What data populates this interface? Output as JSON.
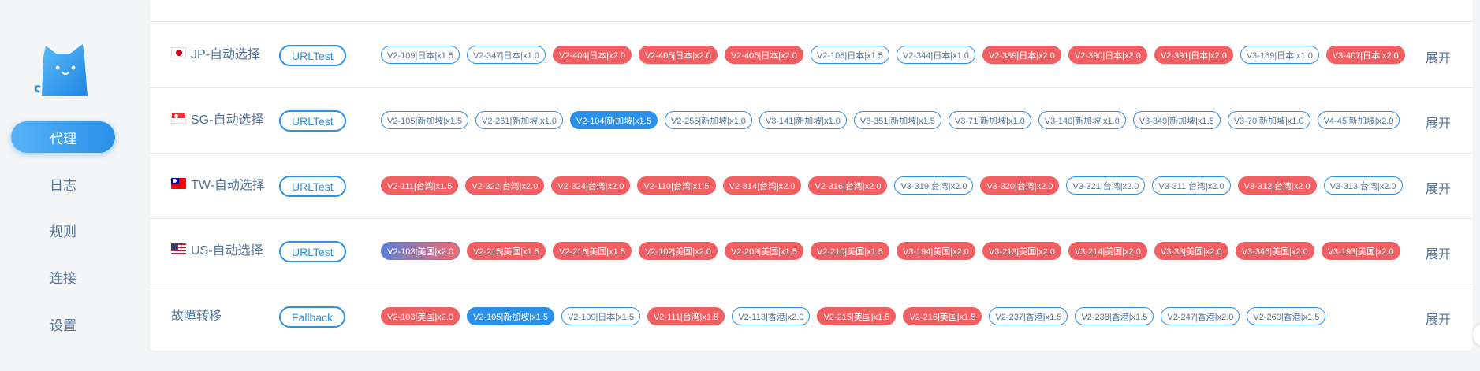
{
  "sidebar": {
    "logo_icon": "cat-logo-icon",
    "items": [
      {
        "label": "代理",
        "active": true
      },
      {
        "label": "日志",
        "active": false
      },
      {
        "label": "规则",
        "active": false
      },
      {
        "label": "连接",
        "active": false
      },
      {
        "label": "设置",
        "active": false
      }
    ]
  },
  "colors": {
    "accent": "#2a90ea",
    "tag_red": "#f25f62",
    "text": "#54759a"
  },
  "groups": [
    {
      "name": "JP-自动选择",
      "flag_icon": "japan-flag-icon",
      "type": "URLTest",
      "expand_label": "展开",
      "proxies": [
        {
          "label": "V2-109|日本|x1.5",
          "style": "outline"
        },
        {
          "label": "V2-347|日本|x1.0",
          "style": "outline"
        },
        {
          "label": "V2-404|日本|x2.0",
          "style": "red"
        },
        {
          "label": "V2-405|日本|x2.0",
          "style": "red"
        },
        {
          "label": "V2-406|日本|x2.0",
          "style": "red"
        },
        {
          "label": "V2-108|日本|x1.5",
          "style": "outline"
        },
        {
          "label": "V2-344|日本|x1.0",
          "style": "outline"
        },
        {
          "label": "V2-389|日本|x2.0",
          "style": "red"
        },
        {
          "label": "V2-390|日本|x2.0",
          "style": "red"
        },
        {
          "label": "V2-391|日本|x2.0",
          "style": "red"
        },
        {
          "label": "V3-189|日本|x1.0",
          "style": "outline"
        },
        {
          "label": "V3-407|日本|x2.0",
          "style": "red"
        }
      ]
    },
    {
      "name": "SG-自动选择",
      "flag_icon": "singapore-flag-icon",
      "type": "URLTest",
      "expand_label": "展开",
      "proxies": [
        {
          "label": "V2-105|新加坡|x1.5",
          "style": "outline"
        },
        {
          "label": "V2-261|新加坡|x1.0",
          "style": "outline"
        },
        {
          "label": "V2-104|新加坡|x1.5",
          "style": "blue"
        },
        {
          "label": "V2-255|新加坡|x1.0",
          "style": "outline"
        },
        {
          "label": "V3-141|新加坡|x1.0",
          "style": "outline"
        },
        {
          "label": "V3-351|新加坡|x1.5",
          "style": "outline"
        },
        {
          "label": "V3-71|新加坡|x1.0",
          "style": "outline"
        },
        {
          "label": "V3-140|新加坡|x1.0",
          "style": "outline"
        },
        {
          "label": "V3-349|新加坡|x1.5",
          "style": "outline"
        },
        {
          "label": "V3-70|新加坡|x1.0",
          "style": "outline"
        },
        {
          "label": "V4-45|新加坡|x2.0",
          "style": "outline"
        }
      ]
    },
    {
      "name": "TW-自动选择",
      "flag_icon": "taiwan-flag-icon",
      "type": "URLTest",
      "expand_label": "展开",
      "proxies": [
        {
          "label": "V2-111|台湾|x1.5",
          "style": "red"
        },
        {
          "label": "V2-322|台湾|x2.0",
          "style": "red"
        },
        {
          "label": "V2-324|台湾|x2.0",
          "style": "red"
        },
        {
          "label": "V2-110|台湾|x1.5",
          "style": "red"
        },
        {
          "label": "V2-314|台湾|x2.0",
          "style": "red"
        },
        {
          "label": "V2-316|台湾|x2.0",
          "style": "red"
        },
        {
          "label": "V3-319|台湾|x2.0",
          "style": "outline"
        },
        {
          "label": "V3-320|台湾|x2.0",
          "style": "red"
        },
        {
          "label": "V3-321|台湾|x2.0",
          "style": "outline"
        },
        {
          "label": "V3-311|台湾|x2.0",
          "style": "outline"
        },
        {
          "label": "V3-312|台湾|x2.0",
          "style": "red"
        },
        {
          "label": "V3-313|台湾|x2.0",
          "style": "outline"
        }
      ]
    },
    {
      "name": "US-自动选择",
      "flag_icon": "usa-flag-icon",
      "type": "URLTest",
      "expand_label": "展开",
      "proxies": [
        {
          "label": "V2-103|美国|x2.0",
          "style": "grad"
        },
        {
          "label": "V2-215|美国|x1.5",
          "style": "red"
        },
        {
          "label": "V2-216|美国|x1.5",
          "style": "red"
        },
        {
          "label": "V2-102|美国|x2.0",
          "style": "red"
        },
        {
          "label": "V2-209|美国|x1.5",
          "style": "red"
        },
        {
          "label": "V2-210|美国|x1.5",
          "style": "red"
        },
        {
          "label": "V3-194|美国|x2.0",
          "style": "red"
        },
        {
          "label": "V3-213|美国|x2.0",
          "style": "red"
        },
        {
          "label": "V3-214|美国|x2.0",
          "style": "red"
        },
        {
          "label": "V3-33|美国|x2.0",
          "style": "red"
        },
        {
          "label": "V3-346|美国|x2.0",
          "style": "red"
        },
        {
          "label": "V3-193|美国|x2.0",
          "style": "red"
        }
      ]
    },
    {
      "name": "故障转移",
      "flag_icon": "",
      "type": "Fallback",
      "expand_label": "展开",
      "proxies": [
        {
          "label": "V2-103|美国|x2.0",
          "style": "red"
        },
        {
          "label": "V2-105|新加坡|x1.5",
          "style": "blue"
        },
        {
          "label": "V2-109|日本|x1.5",
          "style": "outline"
        },
        {
          "label": "V2-111|台湾|x1.5",
          "style": "red"
        },
        {
          "label": "V2-113|香港|x2.0",
          "style": "outline"
        },
        {
          "label": "V2-215|美国|x1.5",
          "style": "red"
        },
        {
          "label": "V2-216|美国|x1.5",
          "style": "red"
        },
        {
          "label": "V2-237|香港|x1.5",
          "style": "outline"
        },
        {
          "label": "V2-238|香港|x1.5",
          "style": "outline"
        },
        {
          "label": "V2-247|香港|x2.0",
          "style": "outline"
        },
        {
          "label": "V2-260|香港|x1.5",
          "style": "outline"
        }
      ]
    }
  ]
}
